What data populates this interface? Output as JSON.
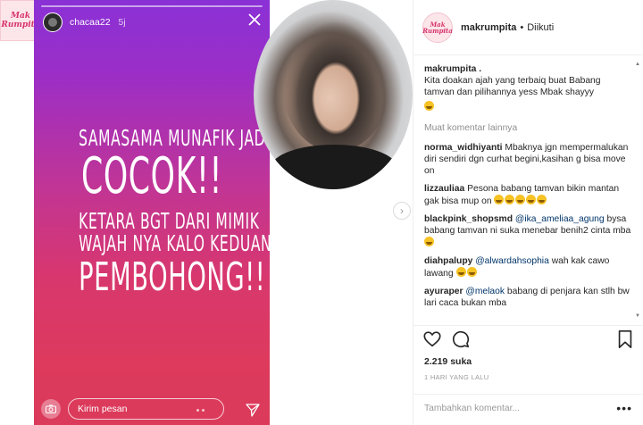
{
  "site_logo": "Mak Rumpita",
  "story": {
    "username": "chacaa22",
    "time": "5j",
    "lines": [
      "SAMASAMA MUNAFIK JADI",
      "COCOK!!",
      "KETARA BGT DARI MIMIK",
      "WAJAH NYA KALO KEDUANYA",
      "PEMBOHONG!!"
    ],
    "message_placeholder": "Kirim pesan"
  },
  "post": {
    "username": "makrumpita",
    "separator": "•",
    "follow_status": "Diikuti",
    "avatar_text": "Mak Rumpita",
    "caption": {
      "user": "makrumpita .",
      "text": "Kita doakan ajah yang terbaiq buat Babang tamvan dan pilihannya yess Mbak shayyy"
    },
    "load_more": "Muat komentar lainnya",
    "comments": [
      {
        "user": "norma_widhiyanti",
        "text": "Mbaknya jgn mempermalukan diri sendiri dgn curhat begini,kasihan g bisa move on",
        "mention": "",
        "emoji": 0
      },
      {
        "user": "lizzauliaa",
        "text": "Pesona babang tamvan bikin mantan gak bisa mup on",
        "mention": "",
        "emoji": 5
      },
      {
        "user": "blackpink_shopsmd",
        "text": "bysa babang tamvan ni suka menebar benih2 cinta mba",
        "mention": "@ika_ameliaa_agung",
        "emoji": 1
      },
      {
        "user": "diahpalupy",
        "text": "wah kak cawo lawang",
        "mention": "@alwardahsophia",
        "emoji": 2
      },
      {
        "user": "ayuraper",
        "text": "babang di penjara kan stlh bw lari caca bukan mba",
        "mention": "@melaok",
        "emoji": 0
      }
    ],
    "likes": "2.219 suka",
    "time_ago": "1 HARI YANG LALU",
    "add_comment_placeholder": "Tambahkan komentar...",
    "more_options": "•••"
  }
}
